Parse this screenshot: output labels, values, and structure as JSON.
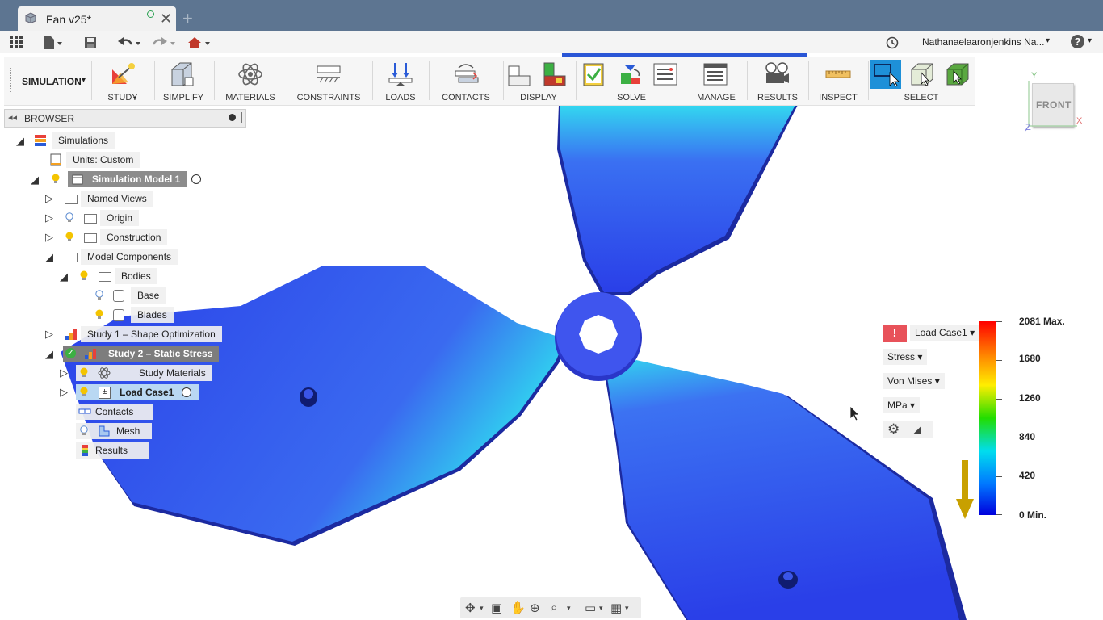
{
  "window": {
    "doc_title": "Fan v25*",
    "close_glyph": "✕",
    "new_tab_glyph": "+"
  },
  "quickbar": {
    "user_name": "Nathanaelaaronjenkins Na...",
    "caret": "▾",
    "help_glyph": "?"
  },
  "ribbon": {
    "workspace": "SIMULATION",
    "groups": [
      {
        "label": "STUDY"
      },
      {
        "label": "SIMPLIFY"
      },
      {
        "label": "MATERIALS"
      },
      {
        "label": "CONSTRAINTS"
      },
      {
        "label": "LOADS"
      },
      {
        "label": "CONTACTS"
      },
      {
        "label": "DISPLAY"
      },
      {
        "label": "SOLVE"
      },
      {
        "label": "MANAGE"
      },
      {
        "label": "RESULTS"
      },
      {
        "label": "INSPECT"
      },
      {
        "label": "SELECT"
      }
    ]
  },
  "viewcube": {
    "face": "FRONT",
    "axis_x": "X",
    "axis_y": "Y",
    "axis_z": "Z"
  },
  "browser": {
    "title": "BROWSER",
    "items": [
      {
        "label": "Simulations"
      },
      {
        "label": "Units: Custom"
      },
      {
        "label": "Simulation Model 1"
      },
      {
        "label": "Named Views"
      },
      {
        "label": "Origin"
      },
      {
        "label": "Construction"
      },
      {
        "label": "Model Components"
      },
      {
        "label": "Bodies"
      },
      {
        "label": "Base"
      },
      {
        "label": "Blades"
      },
      {
        "label": "Study 1 – Shape Optimization"
      },
      {
        "label": "Study 2 – Static Stress"
      },
      {
        "label": "Study Materials"
      },
      {
        "label": "Load Case1"
      },
      {
        "label": "Contacts"
      },
      {
        "label": "Mesh"
      },
      {
        "label": "Results"
      }
    ]
  },
  "legend": {
    "warning_glyph": "!",
    "load_case": "Load Case1",
    "result_type": "Stress",
    "criterion": "Von Mises",
    "unit": "MPa",
    "labels": [
      "2081 Max.",
      "1680",
      "1260",
      "840",
      "420",
      "0 Min."
    ],
    "colors": {
      "max": "#ff0000",
      "min": "#0000dd"
    }
  }
}
